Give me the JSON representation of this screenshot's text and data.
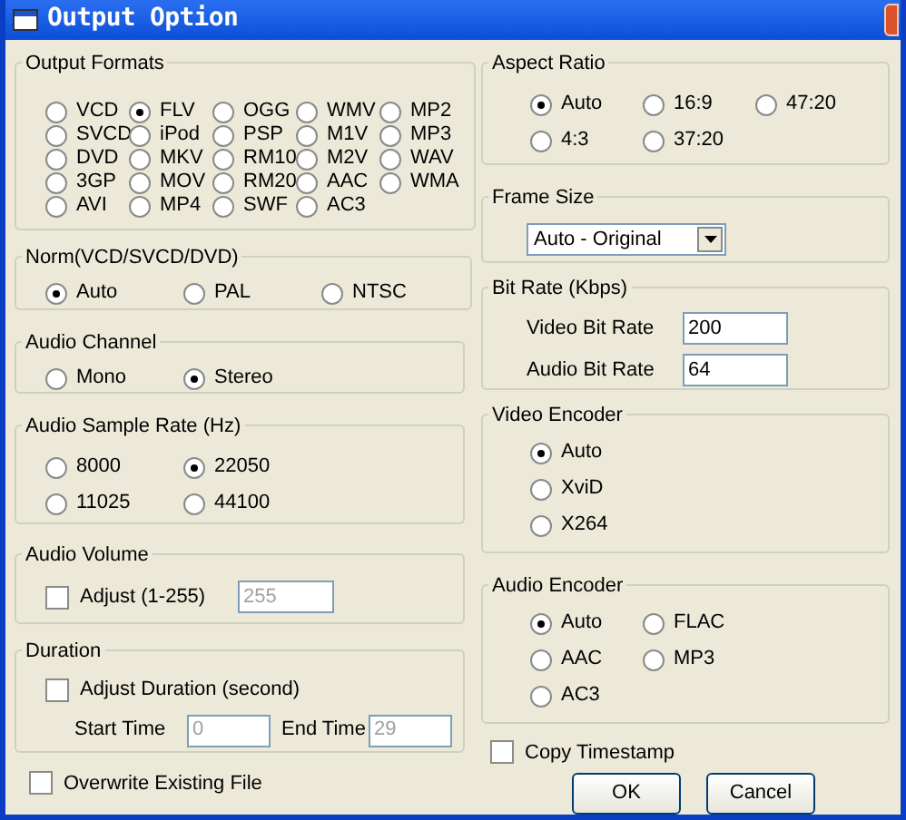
{
  "window": {
    "title": "Output Option"
  },
  "left_groups": [
    {
      "kind": "radio",
      "title": "Output Formats",
      "rows": [
        [
          {
            "label": "VCD",
            "selected": false
          },
          {
            "label": "FLV",
            "selected": true
          },
          {
            "label": "OGG",
            "selected": false
          },
          {
            "label": "WMV",
            "selected": false
          },
          {
            "label": "MP2",
            "selected": false
          }
        ],
        [
          {
            "label": "SVCD",
            "selected": false
          },
          {
            "label": "iPod",
            "selected": false
          },
          {
            "label": "PSP",
            "selected": false
          },
          {
            "label": "M1V",
            "selected": false
          },
          {
            "label": "MP3",
            "selected": false
          }
        ],
        [
          {
            "label": "DVD",
            "selected": false
          },
          {
            "label": "MKV",
            "selected": false
          },
          {
            "label": "RM10",
            "selected": false
          },
          {
            "label": "M2V",
            "selected": false
          },
          {
            "label": "WAV",
            "selected": false
          }
        ],
        [
          {
            "label": "3GP",
            "selected": false
          },
          {
            "label": "MOV",
            "selected": false
          },
          {
            "label": "RM20",
            "selected": false
          },
          {
            "label": "AAC",
            "selected": false
          },
          {
            "label": "WMA",
            "selected": false
          }
        ],
        [
          {
            "label": "AVI",
            "selected": false
          },
          {
            "label": "MP4",
            "selected": false
          },
          {
            "label": "SWF",
            "selected": false
          },
          {
            "label": "AC3",
            "selected": false
          }
        ]
      ]
    },
    {
      "kind": "radio",
      "title": "Norm(VCD/SVCD/DVD)",
      "rows": [
        [
          {
            "label": "Auto",
            "selected": true
          },
          {
            "label": "PAL",
            "selected": false
          },
          {
            "label": "NTSC",
            "selected": false
          }
        ]
      ]
    },
    {
      "kind": "radio",
      "title": "Audio Channel",
      "rows": [
        [
          {
            "label": "Mono",
            "selected": false
          },
          {
            "label": "Stereo",
            "selected": true
          }
        ]
      ]
    },
    {
      "kind": "radio",
      "title": "Audio Sample Rate (Hz)",
      "rows": [
        [
          {
            "label": "8000",
            "selected": false
          },
          {
            "label": "22050",
            "selected": true
          }
        ],
        [
          {
            "label": "11025",
            "selected": false
          },
          {
            "label": "44100",
            "selected": false
          }
        ]
      ]
    },
    {
      "kind": "volume",
      "title": "Audio Volume",
      "checkbox": {
        "label": "Adjust (1-255)",
        "checked": false
      },
      "value": "255"
    },
    {
      "kind": "duration",
      "title": "Duration",
      "checkbox": {
        "label": "Adjust Duration (second)",
        "checked": false
      },
      "start_label": "Start Time",
      "start_value": "0",
      "end_label": "End Time",
      "end_value": "29"
    }
  ],
  "overwrite": {
    "label": "Overwrite Existing File",
    "checked": false
  },
  "right_groups": [
    {
      "kind": "radio",
      "title": "Aspect Ratio",
      "rows": [
        [
          {
            "label": "Auto",
            "selected": true
          },
          {
            "label": "16:9",
            "selected": false
          },
          {
            "label": "47:20",
            "selected": false
          }
        ],
        [
          {
            "label": "4:3",
            "selected": false
          },
          {
            "label": "37:20",
            "selected": false
          }
        ]
      ]
    },
    {
      "kind": "dropdown",
      "title": "Frame Size",
      "value": "Auto - Original"
    },
    {
      "kind": "fields",
      "title": "Bit Rate (Kbps)",
      "fields": [
        {
          "label": "Video Bit Rate",
          "value": "200"
        },
        {
          "label": "Audio Bit Rate",
          "value": "64"
        }
      ]
    },
    {
      "kind": "radio",
      "title": "Video Encoder",
      "rows": [
        [
          {
            "label": "Auto",
            "selected": true
          }
        ],
        [
          {
            "label": "XviD",
            "selected": false
          }
        ],
        [
          {
            "label": "X264",
            "selected": false
          }
        ]
      ]
    },
    {
      "kind": "radio",
      "title": "Audio Encoder",
      "rows": [
        [
          {
            "label": "Auto",
            "selected": true
          },
          {
            "label": "FLAC",
            "selected": false
          }
        ],
        [
          {
            "label": "AAC",
            "selected": false
          },
          {
            "label": "MP3",
            "selected": false
          }
        ],
        [
          {
            "label": "AC3",
            "selected": false
          }
        ]
      ]
    }
  ],
  "copy_timestamp": {
    "label": "Copy Timestamp",
    "checked": false
  },
  "buttons": [
    "OK",
    "Cancel"
  ]
}
